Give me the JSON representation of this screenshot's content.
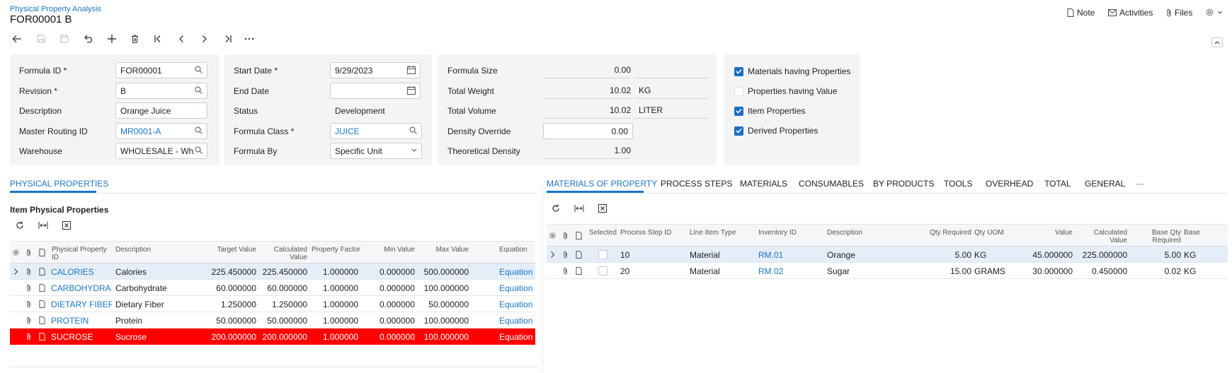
{
  "header": {
    "breadcrumb": "Physical Property Analysis",
    "title": "FOR00001 B",
    "note": "Note",
    "activities": "Activities",
    "files": "Files"
  },
  "form": {
    "formula_id_label": "Formula ID *",
    "formula_id": "FOR00001",
    "revision_label": "Revision *",
    "revision": "B",
    "description_label": "Description",
    "description": "Orange Juice",
    "master_routing_label": "Master Routing ID",
    "master_routing": "MR0001-A",
    "warehouse_label": "Warehouse",
    "warehouse": "WHOLESALE - Wh...",
    "start_date_label": "Start Date *",
    "start_date": "9/29/2023",
    "end_date_label": "End Date",
    "end_date": "",
    "status_label": "Status",
    "status": "Development",
    "formula_class_label": "Formula Class *",
    "formula_class": "JUICE",
    "formula_by_label": "Formula By",
    "formula_by": "Specific Unit",
    "formula_size_label": "Formula Size",
    "formula_size": "0.00",
    "total_weight_label": "Total Weight",
    "total_weight": "10.02",
    "total_weight_uom": "KG",
    "total_volume_label": "Total Volume",
    "total_volume": "10.02",
    "total_volume_uom": "LITER",
    "density_override_label": "Density Override",
    "density_override": "0.00",
    "theoretical_density_label": "Theoretical Density",
    "theoretical_density": "1.00"
  },
  "options": [
    {
      "label": "Materials having Properties",
      "checked": true
    },
    {
      "label": "Properties having Value",
      "checked": false
    },
    {
      "label": "Item Properties",
      "checked": true
    },
    {
      "label": "Derived Properties",
      "checked": true
    }
  ],
  "left_tab": "PHYSICAL PROPERTIES",
  "left_section_title": "Item Physical Properties",
  "left_grid": {
    "headers": [
      "Physical Property ID",
      "Description",
      "Target Value",
      "Calculated Value",
      "Property Factor",
      "Min Value",
      "Max Value",
      "Equation"
    ],
    "rows": [
      {
        "id": "CALORIES",
        "desc": "Calories",
        "target": "225.450000",
        "calc": "225.450000",
        "factor": "1.000000",
        "min": "0.000000",
        "max": "500.000000",
        "eq": "Equation"
      },
      {
        "id": "CARBOHYDRA...",
        "desc": "Carbohydrate",
        "target": "60.000000",
        "calc": "60.000000",
        "factor": "1.000000",
        "min": "0.000000",
        "max": "100.000000",
        "eq": "Equation"
      },
      {
        "id": "DIETARY FIBER",
        "desc": "Dietary Fiber",
        "target": "1.250000",
        "calc": "1.250000",
        "factor": "1.000000",
        "min": "0.000000",
        "max": "50.000000",
        "eq": "Equation"
      },
      {
        "id": "PROTEIN",
        "desc": "Protein",
        "target": "50.000000",
        "calc": "50.000000",
        "factor": "1.000000",
        "min": "0.000000",
        "max": "100.000000",
        "eq": "Equation"
      },
      {
        "id": "SUCROSE",
        "desc": "Sucrose",
        "target": "200.000000",
        "calc": "200.000000",
        "factor": "1.000000",
        "min": "0.000000",
        "max": "100.000000",
        "eq": "Equation"
      }
    ]
  },
  "right_tabs": [
    "MATERIALS OF PROPERTY",
    "PROCESS STEPS",
    "MATERIALS",
    "CONSUMABLES",
    "BY PRODUCTS",
    "TOOLS",
    "OVERHEAD",
    "TOTAL",
    "GENERAL",
    "···"
  ],
  "right_grid": {
    "headers": [
      "Selected",
      "Process Step ID",
      "Line Item Type",
      "Inventory ID",
      "Description",
      "Qty Required",
      "Qty UOM",
      "Value",
      "Calculated Value",
      "Base Qty Required",
      "Base"
    ],
    "rows": [
      {
        "step": "10",
        "type": "Material",
        "inv": "RM.01",
        "desc": "Orange",
        "qty": "5.00",
        "uom": "KG",
        "value": "45.000000",
        "calc": "225.000000",
        "base_qty": "5.00",
        "base": "KG"
      },
      {
        "step": "20",
        "type": "Material",
        "inv": "RM.02",
        "desc": "Sugar",
        "qty": "15.00",
        "uom": "GRAMS",
        "value": "30.000000",
        "calc": "0.450000",
        "base_qty": "0.02",
        "base": "KG"
      }
    ]
  },
  "colors": {
    "accent": "#1a75c8",
    "error_row": "#ff0000",
    "selected_row": "#e5eef8"
  }
}
